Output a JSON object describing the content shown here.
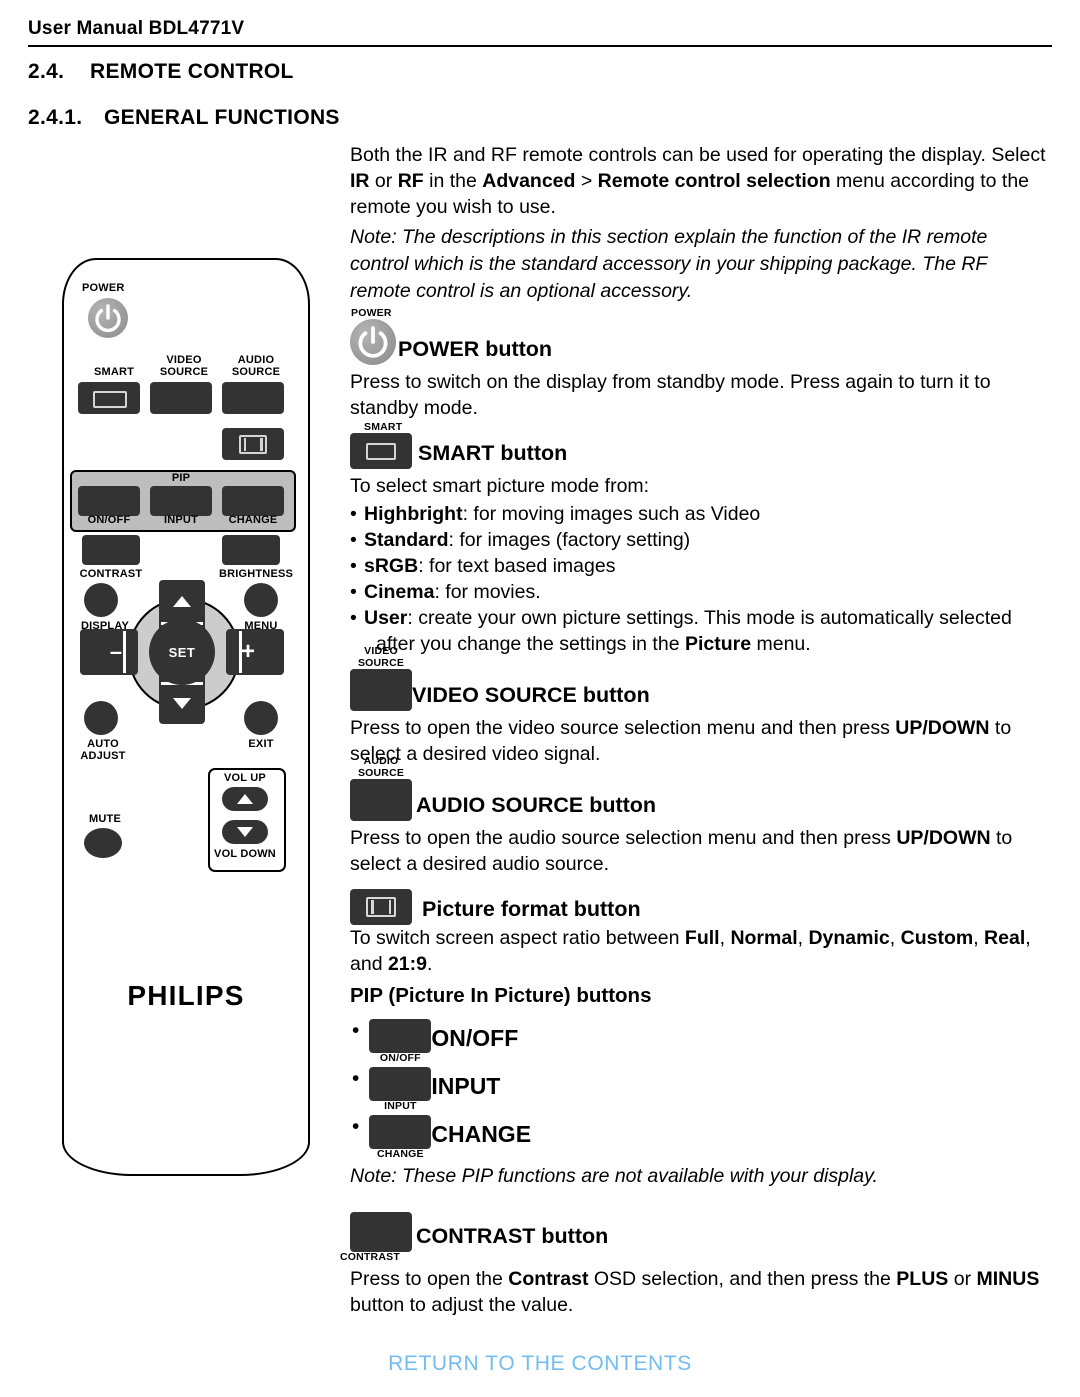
{
  "header": {
    "manual_title": "User Manual BDL4771V"
  },
  "sections": {
    "s24_number": "2.4.",
    "s24_title": "REMOTE CONTROL",
    "s241_number": "2.4.1.",
    "s241_title": "GENERAL FUNCTIONS"
  },
  "intro": {
    "p1_a": "Both the IR and RF remote controls can be used for operating the display. Select ",
    "p1_b_ir": "IR",
    "p1_c": " or ",
    "p1_b_rf": "RF",
    "p1_d": " in the ",
    "p1_b_adv": "Advanced",
    "p1_e": " > ",
    "p1_b_rcs": "Remote control selection",
    "p1_f": " menu according to the remote you wish to use.",
    "note": "Note: The descriptions in this section explain the function of the IR remote control which is the standard accessory in your shipping package. The RF remote control is an optional accessory."
  },
  "power": {
    "caption": "POWER",
    "title_bold": "POWER",
    "title_rest": " button",
    "desc": "Press to switch on the display from standby mode. Press again to turn it to standby mode.",
    "icon": "power-icon"
  },
  "smart": {
    "caption": "SMART",
    "title_bold": "SMART",
    "title_rest": " button",
    "lead": "To select smart picture mode from:",
    "modes": [
      {
        "name": "Highbright",
        "desc": ": for moving images such as Video"
      },
      {
        "name": "Standard",
        "desc": ": for images (factory setting)"
      },
      {
        "name": "sRGB",
        "desc": ": for text based images"
      },
      {
        "name": "Cinema",
        "desc": ": for movies."
      },
      {
        "name": "User",
        "desc": ": create your own picture settings. This mode is automatically selected"
      }
    ],
    "user_cont_a": "after you change the settings in the ",
    "user_cont_b": "Picture",
    "user_cont_c": " menu."
  },
  "video_source": {
    "caption": "VIDEO\nSOURCE",
    "title_bold": "VIDEO SOURCE",
    "title_rest": " button",
    "desc_a": "Press to open the video source selection menu and then press ",
    "desc_b": "UP/DOWN",
    "desc_c": " to select a desired video signal."
  },
  "audio_source": {
    "caption": "AUDIO\nSOURCE",
    "title_bold": "AUDIO SOURCE",
    "title_rest": " button",
    "desc_a": "Press to open the audio source selection menu and then press ",
    "desc_b": "UP/DOWN",
    "desc_c": " to select a desired audio source."
  },
  "picture_format": {
    "title_bold": "Picture format",
    "title_rest": " button",
    "desc_a": "To switch screen aspect ratio between ",
    "opt1": "Full",
    "opt2": "Normal",
    "opt3": "Dynamic",
    "opt4": "Custom",
    "opt5": "Real",
    "opt6": "21:9",
    "desc_mid": ", and ",
    "desc_end": ".",
    "icon": "picture-format-icon"
  },
  "pip": {
    "heading_a": "PIP (",
    "heading_b": "P",
    "heading_c": "icture ",
    "heading_d": "I",
    "heading_e": "n ",
    "heading_f": "P",
    "heading_g": "icture) buttons",
    "heading_plain": "PIP (Picture In Picture) buttons",
    "items": [
      {
        "caption": "ON/OFF",
        "label": "ON/OFF"
      },
      {
        "caption": "INPUT",
        "label": "INPUT"
      },
      {
        "caption": "CHANGE",
        "label": "CHANGE"
      }
    ],
    "note": "Note: These PIP functions are not available with your display."
  },
  "contrast": {
    "caption": "CONTRAST",
    "title_bold": "CONTRAST",
    "title_rest": " button",
    "desc_a": "Press to open the ",
    "desc_b": "Contrast",
    "desc_c": " OSD selection, and then press the ",
    "desc_d": "PLUS",
    "desc_e": " or ",
    "desc_f": "MINUS",
    "desc_g": " button to adjust the value."
  },
  "remote_diagram": {
    "brand": "PHILIPS",
    "labels": {
      "power": "POWER",
      "smart": "SMART",
      "video_source": "VIDEO\nSOURCE",
      "audio_source": "AUDIO\nSOURCE",
      "pip": "PIP",
      "pip_onoff": "ON/OFF",
      "pip_input": "INPUT",
      "pip_change": "CHANGE",
      "contrast": "CONTRAST",
      "brightness": "BRIGHTNESS",
      "display": "DISPLAY",
      "menu": "MENU",
      "set": "SET",
      "minus": "–",
      "plus": "+",
      "auto_adjust": "AUTO\nADJUST",
      "exit": "EXIT",
      "mute": "MUTE",
      "vol_up": "VOL UP",
      "vol_down": "VOL DOWN"
    }
  },
  "footer": {
    "return_link": "RETURN TO THE CONTENTS"
  },
  "colors": {
    "button_dark": "#333333",
    "pip_band": "#bdbdbd",
    "dpad": "#cccccc",
    "power_grey": "#9c9c9c",
    "link_blue": "#74bbef",
    "text": "#000000"
  }
}
